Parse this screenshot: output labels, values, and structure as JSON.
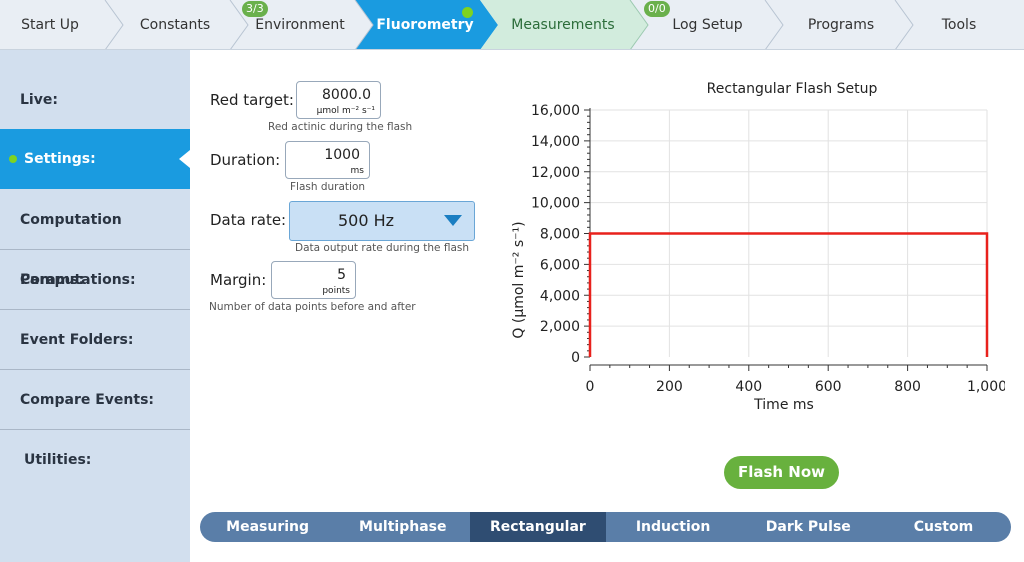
{
  "topnav": {
    "tabs": [
      {
        "label": "Start Up"
      },
      {
        "label": "Constants"
      },
      {
        "label": "Environment",
        "badge": "3/3"
      },
      {
        "label": "Fluorometry",
        "state": "active"
      },
      {
        "label": "Measurements",
        "state": "next"
      },
      {
        "label": "Log Setup",
        "badge": "0/0"
      },
      {
        "label": "Programs"
      },
      {
        "label": "Tools"
      }
    ]
  },
  "sidebar": {
    "items": [
      {
        "label": "Live:"
      },
      {
        "label": "Settings:",
        "state": "active"
      },
      {
        "label": "Computation Params:"
      },
      {
        "label": "Computations:"
      },
      {
        "label": "Event Folders:"
      },
      {
        "label": "Compare Events:"
      },
      {
        "label": "Utilities:"
      }
    ]
  },
  "settings": {
    "red_target": {
      "label": "Red target:",
      "value": "8000.0",
      "unit": "µmol m⁻² s⁻¹",
      "hint": "Red actinic during the flash"
    },
    "duration": {
      "label": "Duration:",
      "value": "1000",
      "unit": "ms",
      "hint": "Flash duration"
    },
    "data_rate": {
      "label": "Data rate:",
      "value": "500 Hz",
      "hint": "Data output rate during the flash"
    },
    "margin": {
      "label": "Margin:",
      "value": "5",
      "unit": "points",
      "hint": "Number of data points before and after"
    }
  },
  "chart_data": {
    "type": "line",
    "title": "Rectangular Flash Setup",
    "xlabel": "Time ms",
    "ylabel": "Q (µmol m⁻² s⁻¹)",
    "xlim": [
      0,
      1000
    ],
    "ylim": [
      0,
      16000
    ],
    "xticks": [
      0,
      200,
      400,
      600,
      800,
      1000
    ],
    "xtick_labels": [
      "0",
      "200",
      "400",
      "600",
      "800",
      "1,000"
    ],
    "yticks": [
      0,
      2000,
      4000,
      6000,
      8000,
      10000,
      12000,
      14000,
      16000
    ],
    "ytick_labels": [
      "0",
      "2,000",
      "4,000",
      "6,000",
      "8,000",
      "10,000",
      "12,000",
      "14,000",
      "16,000"
    ],
    "grid": true,
    "series": [
      {
        "color": "#e8211c",
        "x": [
          0,
          0,
          1000,
          1000
        ],
        "y": [
          0,
          8000,
          8000,
          0
        ]
      }
    ]
  },
  "flash_button": {
    "label": "Flash Now"
  },
  "bottom_tabs": {
    "items": [
      {
        "label": "Measuring"
      },
      {
        "label": "Multiphase"
      },
      {
        "label": "Rectangular",
        "state": "active"
      },
      {
        "label": "Induction"
      },
      {
        "label": "Dark Pulse"
      },
      {
        "label": "Custom"
      }
    ]
  },
  "colors": {
    "active_blue": "#1a9be0",
    "next_green": "#d2ecdd",
    "accent_green": "#68b13e",
    "line_red": "#e8211c",
    "sidebar_bg": "#d2dfee"
  }
}
